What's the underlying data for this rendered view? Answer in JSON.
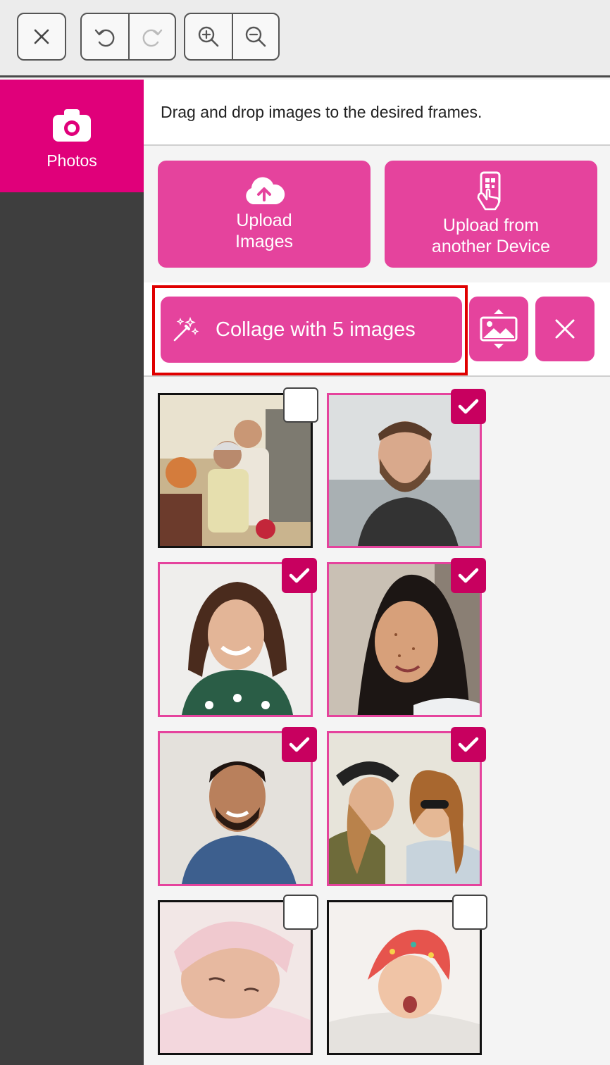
{
  "toolbar": {
    "close_icon": "close-icon",
    "undo_icon": "undo-icon",
    "redo_icon": "redo-icon",
    "zoom_in_icon": "zoom-in-icon",
    "zoom_out_icon": "zoom-out-icon"
  },
  "sidebar": {
    "items": [
      {
        "label": "Photos",
        "icon": "camera-icon",
        "active": true
      }
    ]
  },
  "main": {
    "hint": "Drag and drop images to the desired frames.",
    "upload_images": {
      "line1": "Upload",
      "line2": "Images",
      "icon": "cloud-upload-icon"
    },
    "upload_device": {
      "line1": "Upload from",
      "line2": "another Device",
      "icon": "phone-qr-icon"
    },
    "collage_button": "Collage with 5 images",
    "fit_icon": "fit-image-icon",
    "clear_icon": "close-icon"
  },
  "colors": {
    "accent": "#e5439d",
    "sidebar_active": "#e0007a",
    "checkbox_selected": "#c8005f",
    "sidebar_bg": "#3e3e3e",
    "highlight": "#e00000"
  },
  "photos": [
    {
      "subject": "elderly couple",
      "selected": false
    },
    {
      "subject": "bearded man",
      "selected": true
    },
    {
      "subject": "curly-haired woman",
      "selected": true
    },
    {
      "subject": "freckled woman",
      "selected": true
    },
    {
      "subject": "smiling man",
      "selected": true
    },
    {
      "subject": "two women friends",
      "selected": true
    },
    {
      "subject": "newborn baby",
      "selected": false
    },
    {
      "subject": "baby with headscarf",
      "selected": false
    }
  ]
}
